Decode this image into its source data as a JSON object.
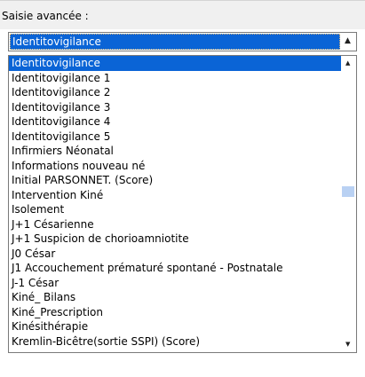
{
  "caption": {
    "label": "Saisie avancée :"
  },
  "combo": {
    "value": "Identitovigilance",
    "dropdown_icon": "triangle-up-icon"
  },
  "list": {
    "items": [
      "Identitovigilance",
      "Identitovigilance 1",
      "Identitovigilance 2",
      "Identitovigilance 3",
      "Identitovigilance 4",
      "Identitovigilance 5",
      "Infirmiers Néonatal",
      "Informations nouveau né",
      "Initial PARSONNET. (Score)",
      "Intervention Kiné",
      "Isolement",
      "J+1 Césarienne",
      "J+1 Suspicion de chorioamniotite",
      "J0 César",
      "J1 Accouchement prématuré spontané - Postnatale",
      "J-1 César",
      "Kiné_ Bilans",
      "Kiné_Prescription",
      "Kinésithérapie",
      "Kremlin-Bicêtre(sortie SSPI) (Score)"
    ],
    "selected_index": 0,
    "scroll_position": 0.45
  },
  "colors": {
    "selection": "#0a64d6",
    "selection_text": "#ffffff",
    "scroll_thumb": "#b9d1f3",
    "caption_background": "#f0f0f0"
  }
}
